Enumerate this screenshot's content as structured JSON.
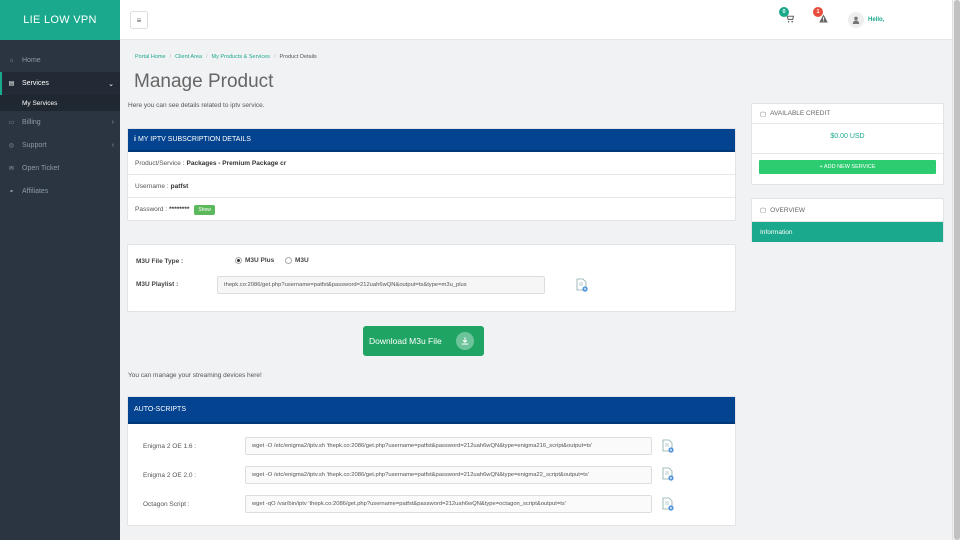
{
  "brand": "LIE LOW VPN",
  "sidebar": {
    "items": [
      {
        "label": "Home",
        "icon": "home-icon"
      },
      {
        "label": "Services",
        "icon": "services-icon"
      },
      {
        "label": "Billing",
        "icon": "billing-icon"
      },
      {
        "label": "Support",
        "icon": "support-icon"
      },
      {
        "label": "Open Ticket",
        "icon": "ticket-icon"
      },
      {
        "label": "Affiliates",
        "icon": "affiliates-icon"
      }
    ],
    "sub_item": "My Services"
  },
  "topbar": {
    "cart_count": "0",
    "alert_count": "1",
    "greeting": "Hello,"
  },
  "breadcrumb": {
    "home": "Portal Home",
    "client_area": "Client Area",
    "products": "My Products & Services",
    "current": "Product Details"
  },
  "page": {
    "title": "Manage Product",
    "intro": "Here you can see details related to iptv service."
  },
  "subscription": {
    "heading": "MY IPTV SUBSCRIPTION DETAILS",
    "product_label": "Product/Service :",
    "product_value": "Packages - Premium Package cr",
    "username_label": "Username :",
    "username_value": "patfst",
    "password_label": "Password :",
    "password_value": "********",
    "show_label": "Show"
  },
  "m3u": {
    "file_type_label": "M3U File Type :",
    "option_plus": "M3U Plus",
    "option_basic": "M3U",
    "playlist_label": "M3U Playlist :",
    "playlist_url": "thepk.co:2086/get.php?username=patfst&password=212uah6wQN&output=ts&type=m3u_plus"
  },
  "download_label": "Download M3u File",
  "manage_text": "You can manage your streaming devices here!",
  "autoscripts": {
    "heading": "AUTO-SCRIPTS",
    "items": [
      {
        "label": "Enigma 2 OE 1.6 :",
        "command": "wget -O /etc/enigma2/iptv.sh 'thepk.co:2086/get.php?username=patfst&password=212uah6wQN&type=enigma216_script&output=ts'"
      },
      {
        "label": "Enigma 2 OE 2.0 :",
        "command": "wget -O /etc/enigma2/iptv.sh 'thepk.co:2086/get.php?username=patfst&password=212uah6wQN&type=enigma22_script&output=ts'"
      },
      {
        "label": "Octagon Script :",
        "command": "wget -qO /var/bin/iptv 'thepk.co:2086/get.php?username=patfst&password=212uah6wQN&type=octagon_script&output=ts'"
      }
    ]
  },
  "credit": {
    "heading": "AVAILABLE CREDIT",
    "amount": "$0.00 USD",
    "add_label": "+ ADD NEW SERVICE"
  },
  "overview": {
    "heading": "OVERVIEW",
    "item": "Information"
  },
  "colors": {
    "accent": "#1aa98d",
    "header_blue": "#034390",
    "sidebar": "#2b3542",
    "download": "#1fa464"
  }
}
